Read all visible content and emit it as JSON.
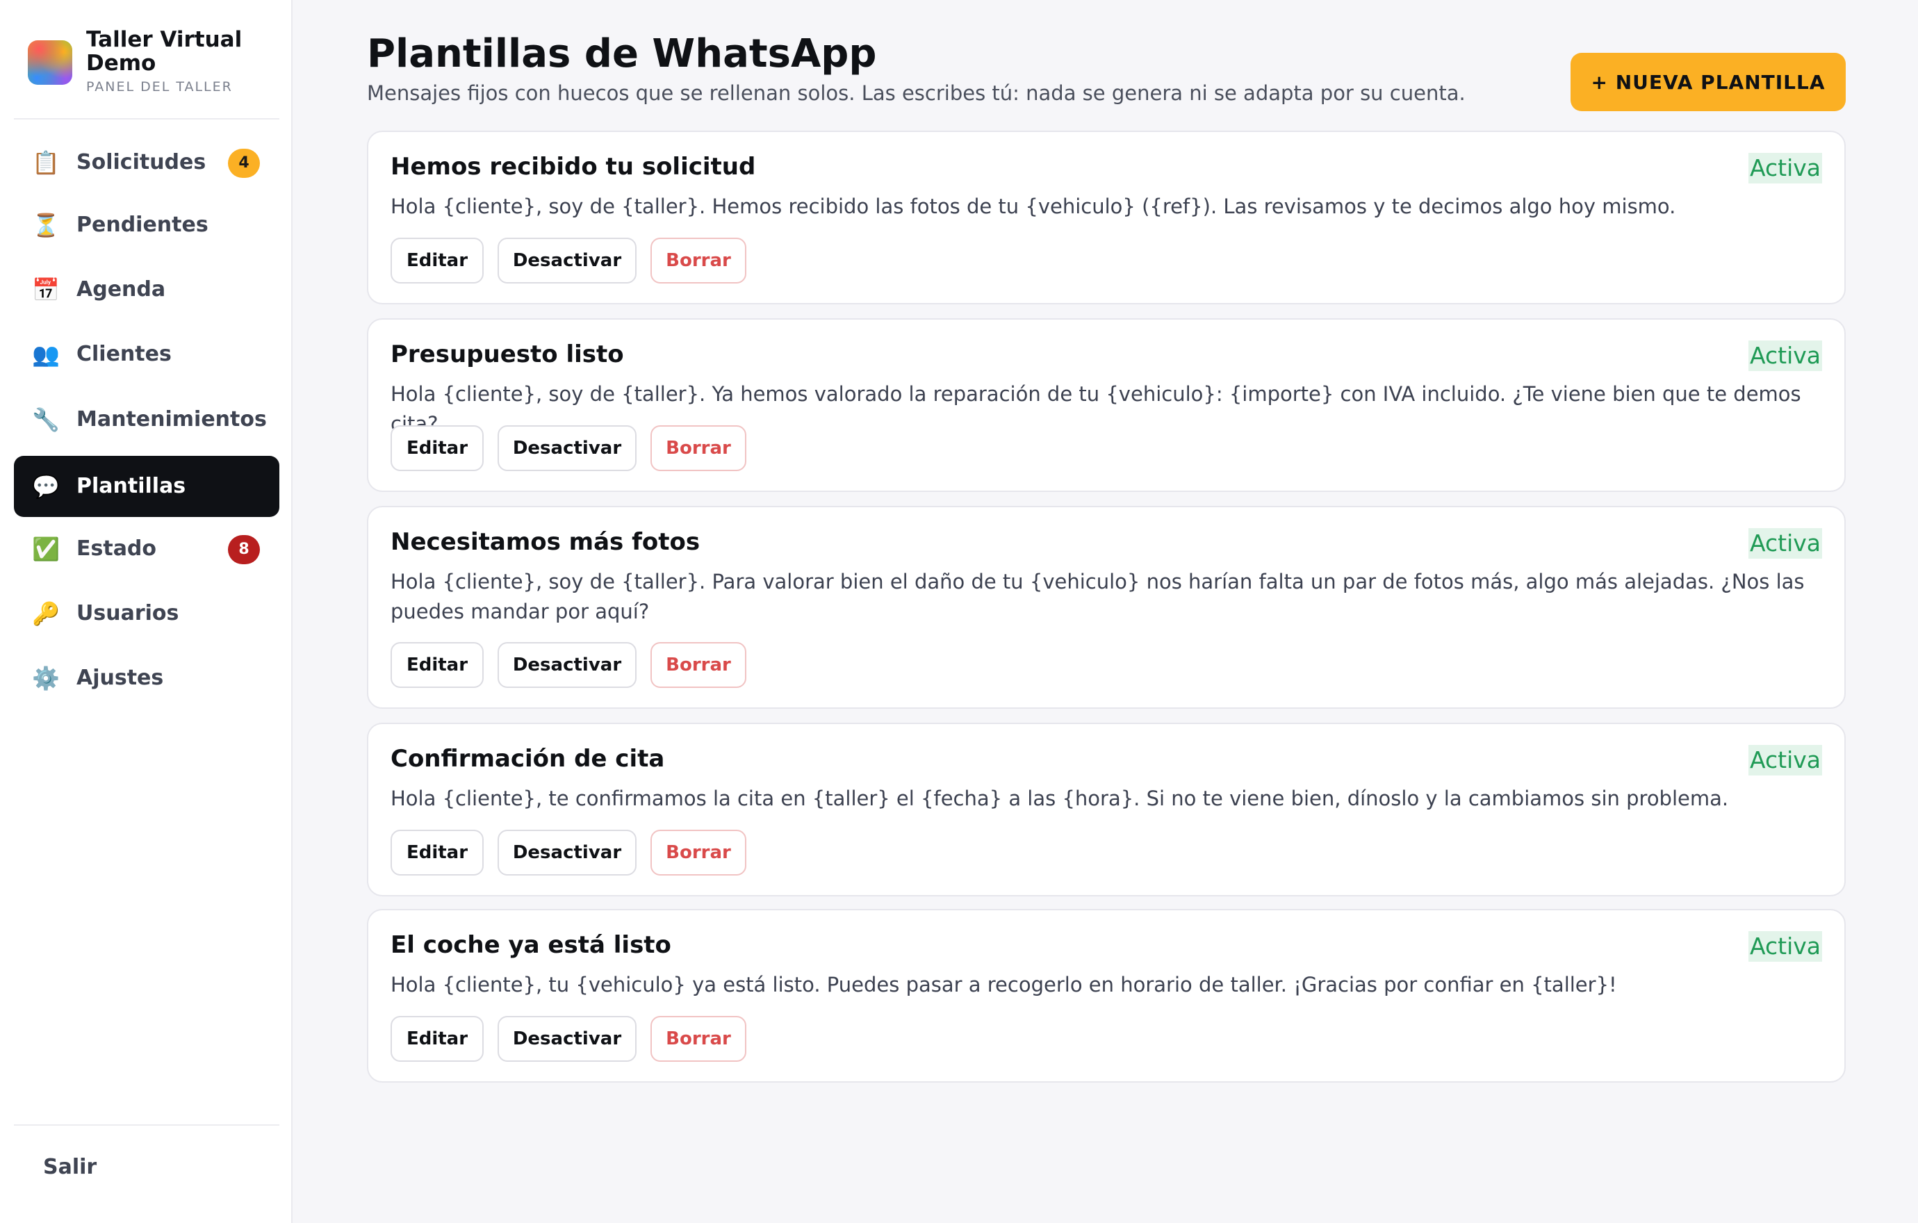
{
  "sidebar": {
    "brand_name": "Taller Virtual Demo",
    "brand_sub": "PANEL DEL TALLER",
    "items": [
      {
        "label": "Solicitudes",
        "icon": "📋",
        "badge": "4"
      },
      {
        "label": "Pendientes",
        "icon": "⏳"
      },
      {
        "label": "Agenda",
        "icon": "📅"
      },
      {
        "label": "Clientes",
        "icon": "👥"
      },
      {
        "label": "Mantenimientos",
        "icon": "🔧"
      },
      {
        "label": "Plantillas",
        "icon": "💬",
        "active": true
      },
      {
        "label": "Estado",
        "icon": "✅",
        "badge": "8"
      },
      {
        "label": "Usuarios",
        "icon": "🔑"
      },
      {
        "label": "Ajustes",
        "icon": "⚙️"
      }
    ],
    "logout_label": "Salir"
  },
  "header": {
    "title": "Plantillas de WhatsApp",
    "subtitle": "Mensajes fijos con huecos que se rellenan solos. Las escribes tú: nada se genera ni se adapta por su cuenta.",
    "new_button_label": "+ NUEVA PLANTILLA"
  },
  "templates": [
    {
      "title": "Hemos recibido tu solicitud",
      "status": "Activa",
      "body": "Hola {cliente}, soy de {taller}. Hemos recibido las fotos de tu {vehiculo} ({ref}). Las revisamos y te decimos algo hoy mismo."
    },
    {
      "title": "Presupuesto listo",
      "status": "Activa",
      "body": "Hola {cliente}, soy de {taller}. Ya hemos valorado la reparación de tu {vehiculo}: {importe} con IVA incluido. ¿Te viene bien que te demos cita?"
    },
    {
      "title": "Necesitamos más fotos",
      "status": "Activa",
      "body": "Hola {cliente}, soy de {taller}. Para valorar bien el daño de tu {vehiculo} nos harían falta un par de fotos más, algo más alejadas. ¿Nos las puedes mandar por aquí?"
    },
    {
      "title": "Confirmación de cita",
      "status": "Activa",
      "body": "Hola {cliente}, te confirmamos la cita en {taller} el {fecha} a las {hora}. Si no te viene bien, díноslo y la cambiamos sin problema."
    },
    {
      "title": "El coche ya está listo",
      "status": "Activa",
      "body": "Hola {cliente}, tu {vehiculo} ya está listo. Puedes pasar a recogerlo en horario de taller. ¡Gracias por confiar en {taller}!"
    }
  ],
  "card_actions": {
    "edit_label": "Editar",
    "deactivate_label": "Desactivar",
    "delete_label": "Borrar"
  },
  "colors": {
    "accent": "#fbb024",
    "active_nav": "#0f1115",
    "status_green": "#1f9a55",
    "delete_red": "#d94a4a",
    "badge_red": "#b81f1f"
  }
}
